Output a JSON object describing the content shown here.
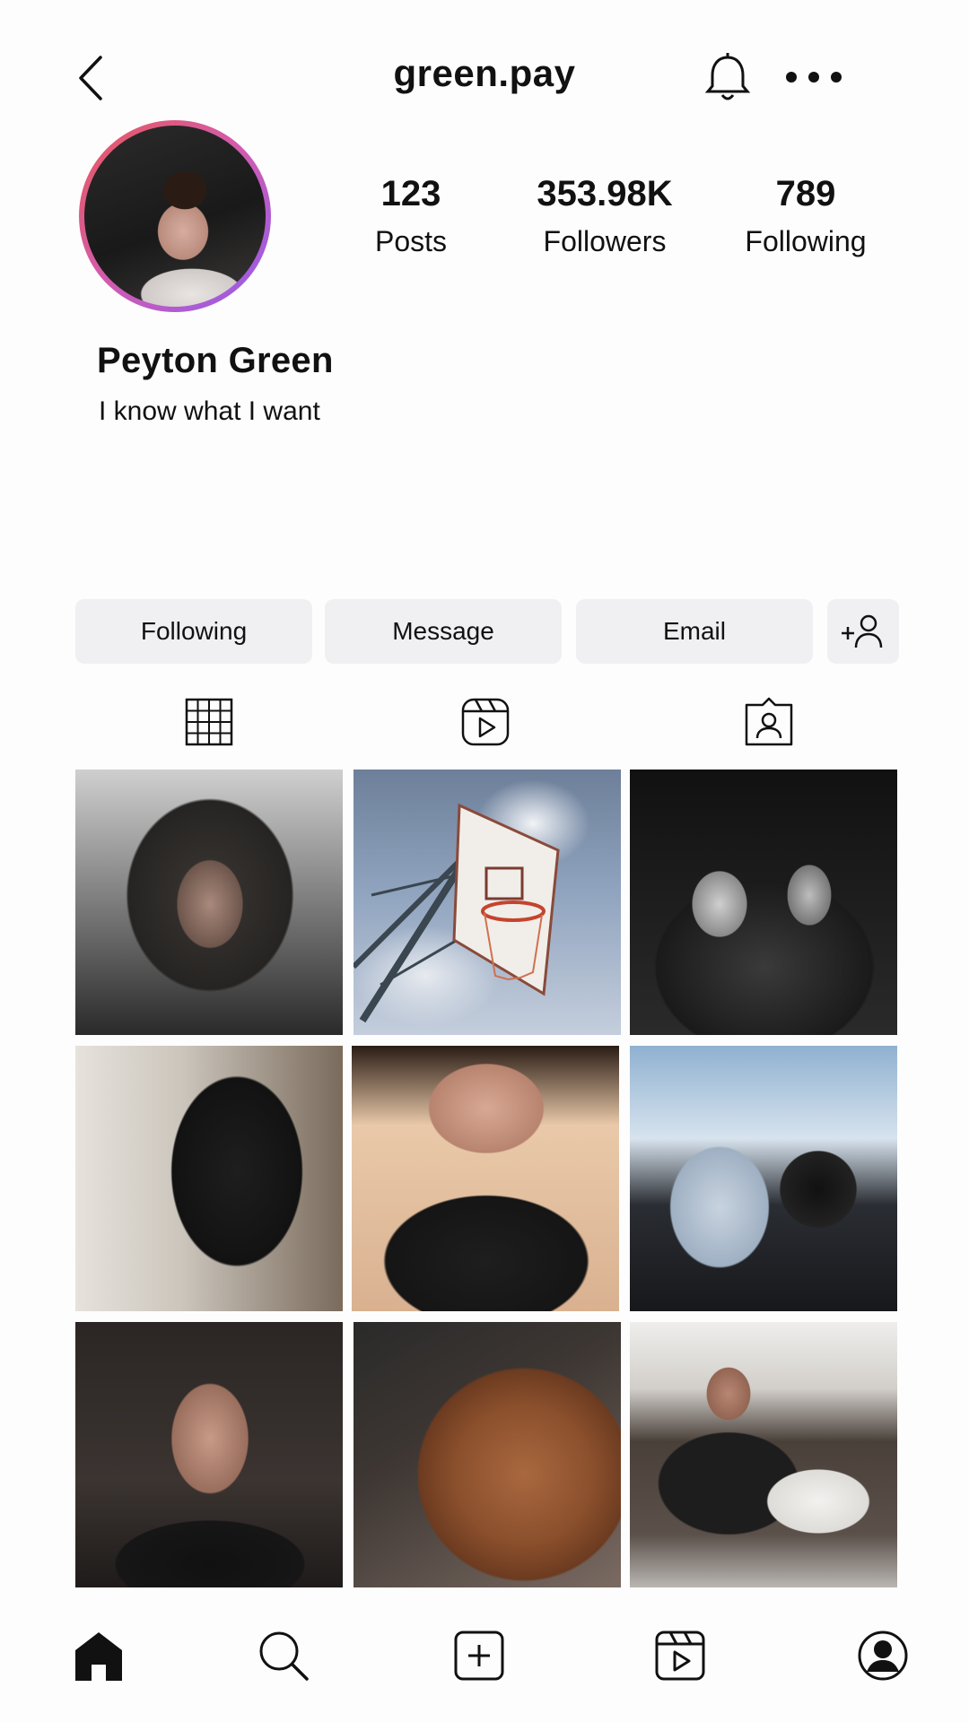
{
  "header": {
    "username": "green.pay",
    "icons": {
      "back": "chevron-left-icon",
      "notifications": "bell-icon",
      "more": "more-horizontal-icon"
    }
  },
  "profile": {
    "name": "Peyton Green",
    "bio": "I know what I want",
    "stats": [
      {
        "value": "123",
        "label": "Posts"
      },
      {
        "value": "353.98K",
        "label": "Followers"
      },
      {
        "value": "789",
        "label": "Following"
      }
    ]
  },
  "actions": {
    "following_label": "Following",
    "message_label": "Message",
    "email_label": "Email",
    "add_icon": "add-person-icon"
  },
  "tabs": [
    "grid-icon",
    "reels-icon",
    "tagged-icon"
  ],
  "posts": [
    {
      "name": "hoodie-selfie"
    },
    {
      "name": "basketball-hoop"
    },
    {
      "name": "group-night"
    },
    {
      "name": "kitchen-back"
    },
    {
      "name": "smiling-face"
    },
    {
      "name": "car-phone"
    },
    {
      "name": "mirror-abs"
    },
    {
      "name": "basketball"
    },
    {
      "name": "couch-eating"
    }
  ],
  "nav": [
    "home-icon",
    "search-icon",
    "create-icon",
    "reels-icon",
    "profile-icon"
  ],
  "colors": {
    "avatar_ring_start": "#e85a5a",
    "avatar_ring_end": "#8f5cf0",
    "button_bg": "#f0f0f2"
  }
}
